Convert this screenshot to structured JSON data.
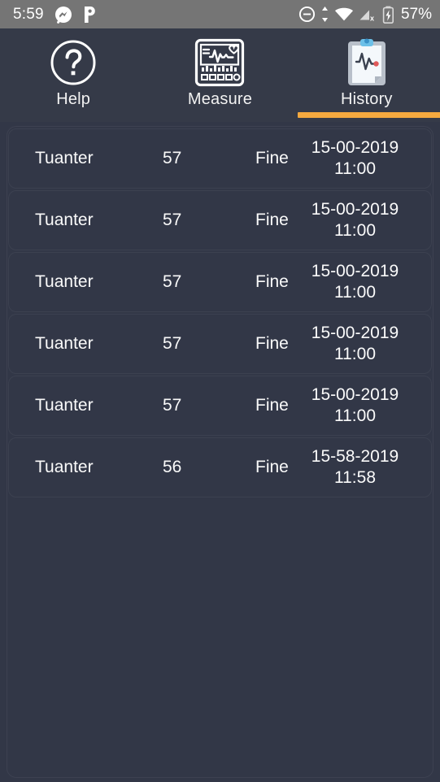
{
  "status_bar": {
    "time": "5:59",
    "battery_percent": "57%",
    "left_icons": [
      "messenger-icon",
      "pandora-icon"
    ],
    "right_icons": [
      "do-not-disturb-icon",
      "data-transfer-icon",
      "wifi-icon",
      "cellular-off-icon",
      "battery-charging-icon"
    ],
    "background_color": "#757575"
  },
  "tabs": {
    "accent_color": "#f5a93f",
    "items": [
      {
        "label": "Help",
        "icon": "help-circle-icon",
        "selected": false
      },
      {
        "label": "Measure",
        "icon": "heart-monitor-icon",
        "selected": false
      },
      {
        "label": "History",
        "icon": "clipboard-ecg-icon",
        "selected": true
      }
    ]
  },
  "history": {
    "rows": [
      {
        "name": "Tuanter",
        "value": "57",
        "state": "Fine",
        "date": "15-00-2019",
        "time": "11:00"
      },
      {
        "name": "Tuanter",
        "value": "57",
        "state": "Fine",
        "date": "15-00-2019",
        "time": "11:00"
      },
      {
        "name": "Tuanter",
        "value": "57",
        "state": "Fine",
        "date": "15-00-2019",
        "time": "11:00"
      },
      {
        "name": "Tuanter",
        "value": "57",
        "state": "Fine",
        "date": "15-00-2019",
        "time": "11:00"
      },
      {
        "name": "Tuanter",
        "value": "57",
        "state": "Fine",
        "date": "15-00-2019",
        "time": "11:00"
      },
      {
        "name": "Tuanter",
        "value": "56",
        "state": "Fine",
        "date": "15-58-2019",
        "time": "11:58"
      }
    ]
  },
  "colors": {
    "content_background": "#323747",
    "tabbar_background": "#353a48",
    "text": "#fafafa"
  }
}
